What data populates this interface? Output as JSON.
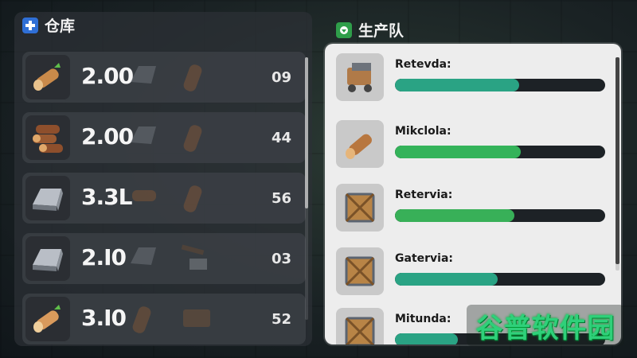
{
  "warehouse": {
    "title": "仓库",
    "icon": "plus-icon",
    "accent": "#2f6fd6",
    "rows": [
      {
        "icon": "log-icon",
        "amount": "2.00",
        "count": "09"
      },
      {
        "icon": "log-pile-icon",
        "amount": "2.00",
        "count": "44"
      },
      {
        "icon": "iron-ingot-icon",
        "amount": "3.3L",
        "count": "56"
      },
      {
        "icon": "iron-ingot-icon",
        "amount": "2.I0",
        "count": "03"
      },
      {
        "icon": "log-icon",
        "amount": "3.I0",
        "count": "52"
      }
    ]
  },
  "production": {
    "title": "生产队",
    "icon": "team-icon",
    "accent": "#2f9e4a",
    "teams": [
      {
        "icon": "wood-cart-icon",
        "name": "Retevda:",
        "progress": 0.59,
        "color": "#2aa384"
      },
      {
        "icon": "log-icon",
        "name": "Mikclola:",
        "progress": 0.6,
        "color": "#34b35a"
      },
      {
        "icon": "crate-icon",
        "name": "Retervia:",
        "progress": 0.57,
        "color": "#38b058"
      },
      {
        "icon": "crate-icon",
        "name": "Gatervia:",
        "progress": 0.49,
        "color": "#2aa384"
      },
      {
        "icon": "crate-icon",
        "name": "Mitunda:",
        "progress": 0.3,
        "color": "#2aa384"
      }
    ]
  },
  "watermark": "谷普软件园"
}
